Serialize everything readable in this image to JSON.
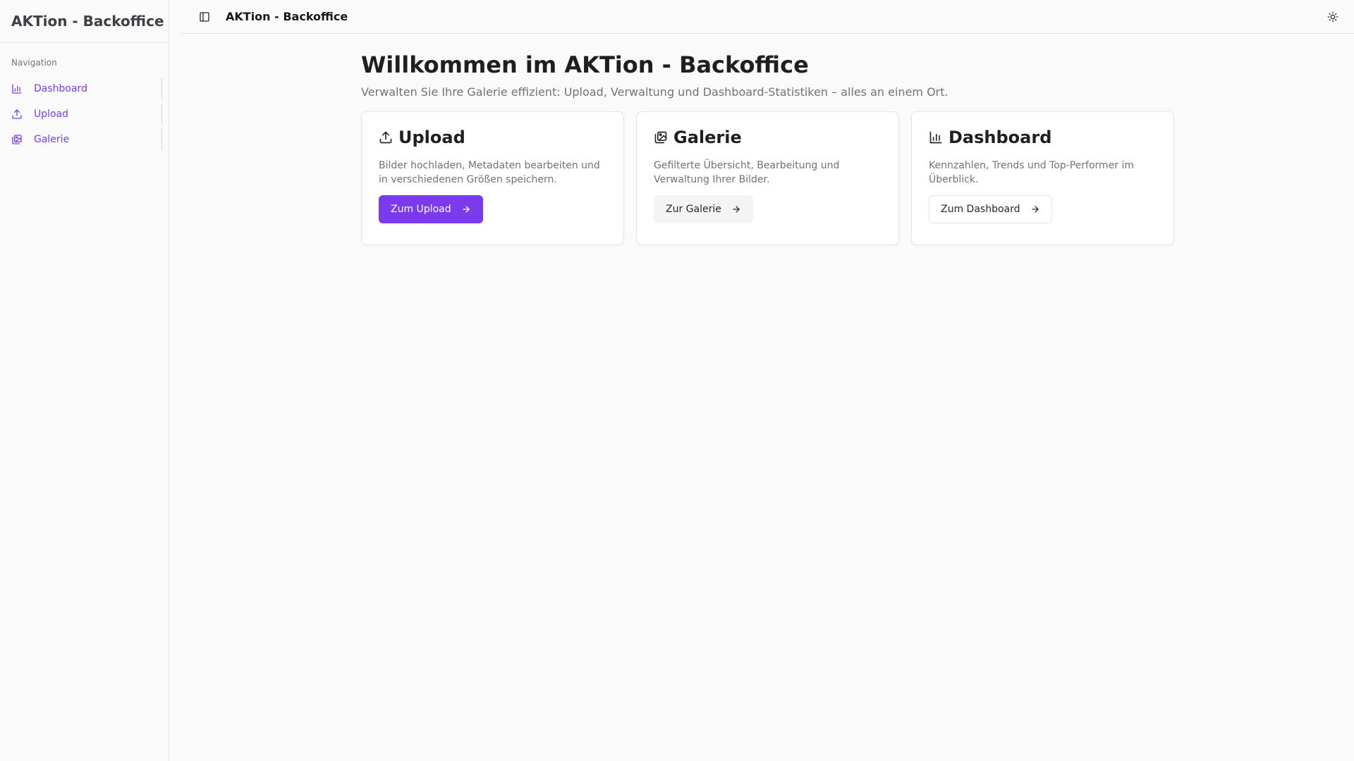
{
  "sidebar": {
    "brand": "AKTion - Backoffice",
    "group_label": "Navigation",
    "items": [
      {
        "label": "Dashboard",
        "icon": "bar-chart-icon"
      },
      {
        "label": "Upload",
        "icon": "upload-icon"
      },
      {
        "label": "Galerie",
        "icon": "gallery-icon"
      }
    ]
  },
  "topbar": {
    "title": "AKTion - Backoffice"
  },
  "main": {
    "title": "Willkommen im AKTion - Backoffice",
    "subtitle": "Verwalten Sie Ihre Galerie effizient: Upload, Verwaltung und Dashboard-Statistiken – alles an einem Ort.",
    "cards": [
      {
        "title": "Upload",
        "icon": "upload-icon",
        "description": "Bilder hochladen, Metadaten bearbeiten und in verschiedenen Größen speichern.",
        "button": "Zum Upload"
      },
      {
        "title": "Galerie",
        "icon": "gallery-icon",
        "description": "Gefilterte Übersicht, Bearbeitung und Verwaltung Ihrer Bilder.",
        "button": "Zur Galerie"
      },
      {
        "title": "Dashboard",
        "icon": "bar-chart-icon",
        "description": "Kennzahlen, Trends und Top-Performer im Überblick.",
        "button": "Zum Dashboard"
      }
    ]
  },
  "colors": {
    "accent": "#7c3aed",
    "muted_text": "#71717a",
    "border": "#e4e4e7"
  }
}
